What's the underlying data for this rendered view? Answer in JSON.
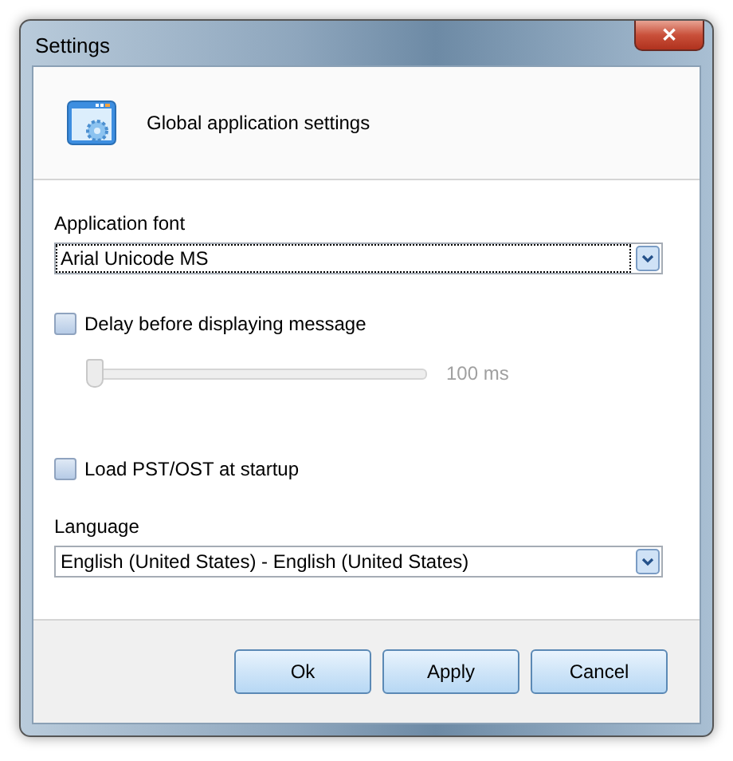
{
  "window": {
    "title": "Settings",
    "close": "✕"
  },
  "header": {
    "title": "Global application settings"
  },
  "font": {
    "label": "Application font",
    "value": "Arial Unicode MS",
    "focused": true
  },
  "delay": {
    "label": "Delay before displaying message",
    "checked": false
  },
  "delay_slider": {
    "level": 0,
    "reading": "100 ms",
    "disabled": true
  },
  "load": {
    "label": "Load PST/OST at startup",
    "checked": false
  },
  "language": {
    "label": "Language",
    "value": "English (United States) - English (United States)",
    "focused": false
  },
  "buttons": [
    {
      "label": "Ok"
    },
    {
      "label": "Apply"
    },
    {
      "label": "Cancel"
    }
  ]
}
